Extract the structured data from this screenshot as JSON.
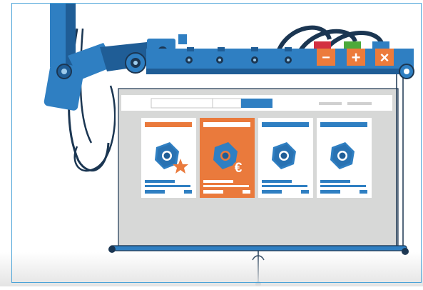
{
  "scene": {
    "colors": {
      "robot_blue": "#2f7fc2",
      "robot_dark": "#1f5d96",
      "cable_navy": "#1b3652",
      "screen_gray": "#d7d8d7",
      "card_orange": "#ea7a3c",
      "card_blue": "#2f7fc2",
      "tag_red": "#d32f40",
      "tag_green": "#4caa3a",
      "tag_blue": "#2f7fc2",
      "button_orange": "#ec7b3b"
    },
    "control_buttons": [
      {
        "icon": "minus-icon",
        "glyph": "−",
        "tag_color": "#d32f40"
      },
      {
        "icon": "plus-icon",
        "glyph": "+",
        "tag_color": "#4caa3a"
      },
      {
        "icon": "close-icon",
        "glyph": "×",
        "tag_color": "#2f7fc2"
      }
    ],
    "product_cards": [
      {
        "icon": "hex-nut-icon",
        "badge": "star-icon",
        "highlighted": false
      },
      {
        "icon": "hex-nut-icon",
        "badge": "euro-icon",
        "badge_text": "€",
        "highlighted": true
      },
      {
        "icon": "hex-nut-icon",
        "badge": "",
        "highlighted": false
      },
      {
        "icon": "hex-nut-icon",
        "badge": "",
        "highlighted": false
      }
    ]
  }
}
